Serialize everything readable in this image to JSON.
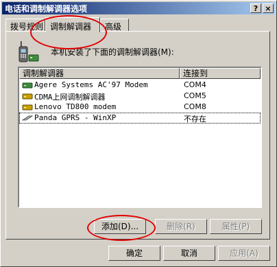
{
  "window": {
    "title": "电话和调制解调器选项",
    "help_btn": "?",
    "close_btn": "×"
  },
  "tabs": [
    {
      "label": "拨号规则"
    },
    {
      "label": "调制解调器"
    },
    {
      "label": "高级"
    }
  ],
  "panel": {
    "description": "本机安装了下面的调制解调器(M):"
  },
  "list": {
    "columns": [
      "调制解调器",
      "连接到"
    ],
    "rows": [
      {
        "name": "Agere Systems AC'97 Modem",
        "port": "COM4",
        "icon": "modem-icon"
      },
      {
        "name": "CDMA上网调制解调器",
        "port": "COM5",
        "icon": "modem-icon"
      },
      {
        "name": "Lenovo TD800 modem",
        "port": "COM8",
        "icon": "modem-icon"
      },
      {
        "name": "Panda GPRS - WinXP",
        "port": "不存在",
        "icon": "cable-modem-icon"
      }
    ]
  },
  "buttons": {
    "add": "添加(D)...",
    "remove": "删除(R)",
    "properties": "属性(P)",
    "ok": "确定",
    "cancel": "取消",
    "apply": "应用(A)"
  }
}
